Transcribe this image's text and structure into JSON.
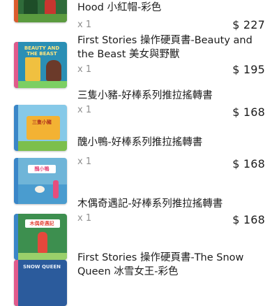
{
  "items": [
    {
      "title": "Hood 小紅帽-彩色",
      "qty": "x 1",
      "price": "$ 227",
      "colors": {
        "bg": "#2f6b3a",
        "accent": "#c8362f",
        "spine": "#dc5c2e"
      }
    },
    {
      "title": "First Stories 操作硬頁書-Beauty and the Beast 美女與野獸",
      "qty": "x 1",
      "price": "$ 195",
      "cover_text": "BEAUTY AND THE BEAST",
      "colors": {
        "bg": "#2a8fb5",
        "accent": "#f0c040",
        "spine": "#e15a8c"
      }
    },
    {
      "title": "三隻小豬-好棒系列推拉搖轉書",
      "qty": "x 1",
      "price": "$ 168",
      "cover_text": "三隻小豬",
      "colors": {
        "bg": "#86c9e8",
        "accent": "#f3b233",
        "spine": "#3a86c8"
      }
    },
    {
      "title": "醜小鴨-好棒系列推拉搖轉書",
      "qty": "x 1",
      "price": "$ 168",
      "cover_text": "醜小鴨",
      "colors": {
        "bg": "#6fb5d8",
        "accent": "#e74d7d",
        "spine": "#3a86c8"
      }
    },
    {
      "title": "木偶奇遇記-好棒系列推拉搖轉書",
      "qty": "x 1",
      "price": "$ 168",
      "cover_text": "木偶奇遇記",
      "colors": {
        "bg": "#3d8f4f",
        "accent": "#e5483c",
        "spine": "#3a86c8"
      }
    },
    {
      "title": "First Stories 操作硬頁書-The Snow Queen 冰雪女王-彩色",
      "qty": "",
      "price": "",
      "cover_text": "SNOW QUEEN",
      "colors": {
        "bg": "#2b5b9c",
        "accent": "#e6eef8",
        "spine": "#e15a8c"
      }
    }
  ]
}
